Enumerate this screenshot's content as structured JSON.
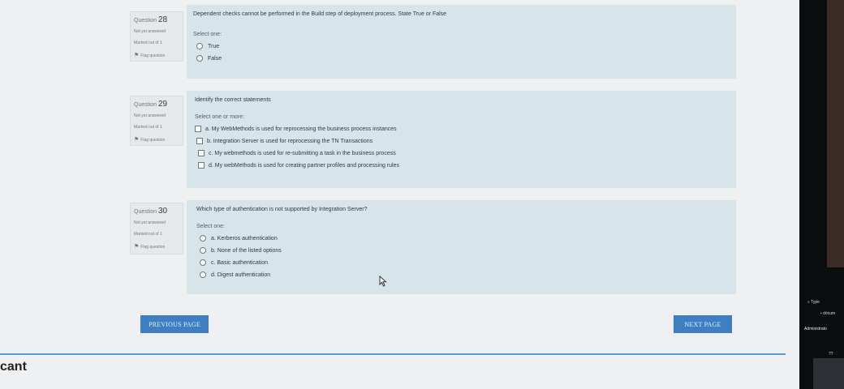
{
  "questions": [
    {
      "number_label": "Question",
      "number": "28",
      "state": "Not yet answered",
      "marks": "Marked out of 1",
      "flag": "Flag question",
      "text": "Dependent checks cannot be performed in the Build step of deployment process. State True or False",
      "prompt": "Select one:",
      "options": [
        "True",
        "False"
      ]
    },
    {
      "number_label": "Question",
      "number": "29",
      "state": "Not yet answered",
      "marks": "Marked out of 1",
      "flag": "Flag question",
      "text": "Identify the correct statements",
      "prompt": "Select one or more:",
      "options": [
        "a. My WebMethods is used for reprocessing the business process instances",
        "b. Integration Server is used for reprocessing the TN Transactions",
        "c. My webmethods is used for re-submitting a task in the business process",
        "d. My webMethods is used for creating partner profiles and processing rules"
      ]
    },
    {
      "number_label": "Question",
      "number": "30",
      "state": "Not yet answered",
      "marks": "Marked out of 1",
      "flag": "Flag question",
      "text": "Which type of authentication is not supported by Integration Server?",
      "prompt": "Select one:",
      "options": [
        "a. Kerberos authentication",
        "b. None of the listed options",
        "c. Basic authentication",
        "d. Digest authentication"
      ]
    }
  ],
  "nav": {
    "previous": "PREVIOUS PAGE",
    "next": "NEXT PAGE"
  },
  "fragment": "cant",
  "side": {
    "line1": "Type",
    "line2": "docum",
    "line3": "Administrato",
    "line4": "??"
  },
  "colors": {
    "accent": "#3d7fc2",
    "card": "#d7e5ea"
  }
}
